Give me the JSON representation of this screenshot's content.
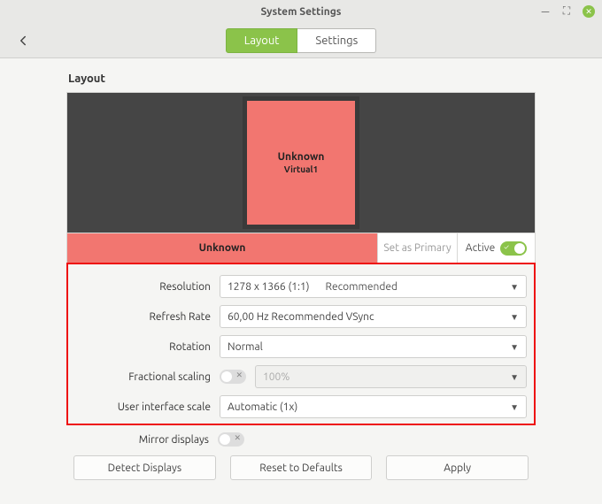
{
  "window": {
    "title": "System Settings"
  },
  "tabs": {
    "layout": "Layout",
    "settings": "Settings",
    "active": "layout"
  },
  "section": {
    "title": "Layout"
  },
  "monitor": {
    "name": "Unknown",
    "port": "Virtual1",
    "badge": "Unknown",
    "set_primary": "Set as Primary",
    "active_label": "Active",
    "active_on": true
  },
  "settings": {
    "resolution": {
      "label": "Resolution",
      "value": "1278 x 1366 (1:1)",
      "extra": "Recommended"
    },
    "refresh": {
      "label": "Refresh Rate",
      "value": "60,00 Hz   Recommended   VSync"
    },
    "rotation": {
      "label": "Rotation",
      "value": "Normal"
    },
    "fractional": {
      "label": "Fractional scaling",
      "enabled": false,
      "value": "100%"
    },
    "uiscale": {
      "label": "User interface scale",
      "value": "Automatic (1x)"
    }
  },
  "mirror": {
    "label": "Mirror displays",
    "enabled": false
  },
  "buttons": {
    "detect": "Detect Displays",
    "reset": "Reset to Defaults",
    "apply": "Apply"
  }
}
